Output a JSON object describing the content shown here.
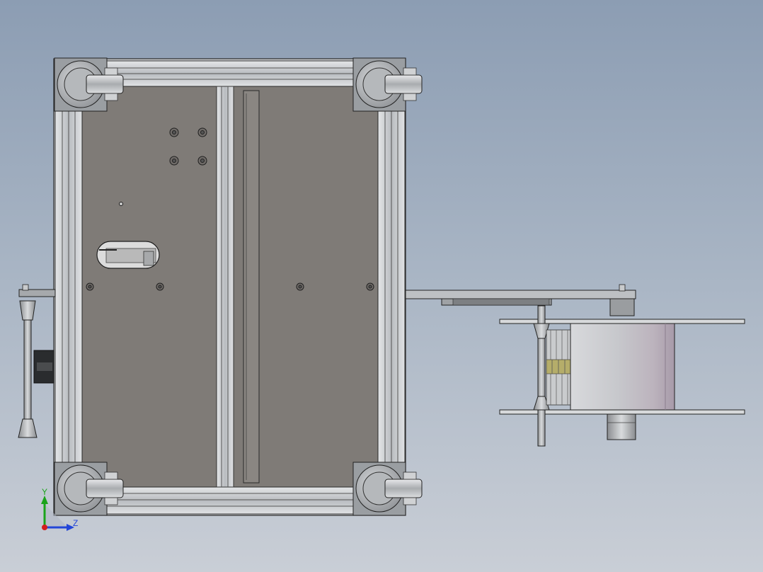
{
  "viewport": {
    "background_top": "#8c9db3",
    "background_bottom": "#c9ced6"
  },
  "model": {
    "frame_color": "#c8cbce",
    "panel_color": "#7f7b77",
    "edge_color": "#2a2a2a",
    "caster_color": "#b4b7ba",
    "spool_color": "#c2c4c8",
    "bracket_color": "#9a9ea2",
    "label_strip_color": "#b5ad6a"
  },
  "triad": {
    "y_label": "Y",
    "z_label": "Z",
    "y_color": "#1aa31a",
    "z_color": "#2346d8",
    "x_color": "#d21e1e"
  }
}
